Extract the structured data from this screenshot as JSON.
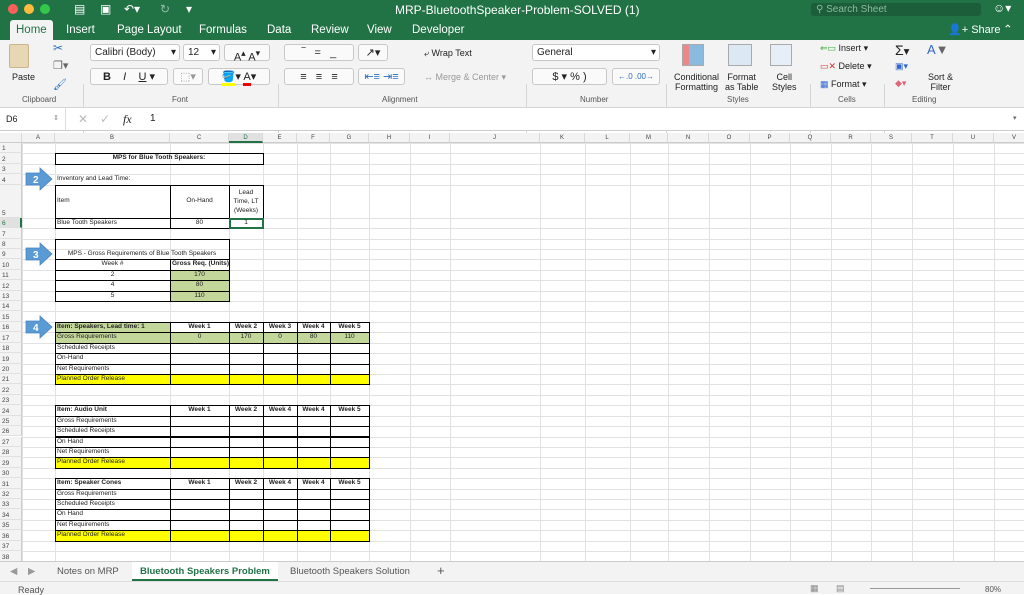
{
  "window": {
    "title": "MRP-BluetoothSpeaker-Problem-SOLVED (1)",
    "search_placeholder": "Search Sheet",
    "share_label": "Share"
  },
  "ribbon_tabs": [
    "Home",
    "Insert",
    "Page Layout",
    "Formulas",
    "Data",
    "Review",
    "View",
    "Developer"
  ],
  "active_tab": "Home",
  "ribbon": {
    "paste": "Paste",
    "font_name": "Calibri (Body)",
    "font_size": "12",
    "bold": "B",
    "italic": "I",
    "underline": "U",
    "wrap_text": "Wrap Text",
    "merge_center": "Merge & Center",
    "number_format": "General",
    "currency": "$",
    "percent": "%",
    "comma": ")",
    "conditional_formatting": [
      "Conditional",
      "Formatting"
    ],
    "format_as_table": [
      "Format",
      "as Table"
    ],
    "cell_styles": [
      "Cell",
      "Styles"
    ],
    "insert": "Insert",
    "delete": "Delete",
    "format": "Format",
    "sort_filter": [
      "Sort &",
      "Filter"
    ],
    "groups": {
      "clipboard": "Clipboard",
      "font": "Font",
      "alignment": "Alignment",
      "number": "Number",
      "styles": "Styles",
      "cells": "Cells",
      "editing": "Editing"
    }
  },
  "formula_bar": {
    "name_box": "D6",
    "formula": "1",
    "fx": "fx"
  },
  "columns": [
    "A",
    "B",
    "C",
    "D",
    "E",
    "F",
    "G",
    "H",
    "I",
    "J",
    "K",
    "L",
    "M",
    "N",
    "O",
    "P",
    "Q",
    "R",
    "S",
    "T",
    "U",
    "V"
  ],
  "selected_cell": "D6",
  "colors": {
    "green_fill": "#c4d79b",
    "yellow_fill": "#ffff00",
    "accent": "#217346",
    "arrow": "#5b9bd5"
  },
  "callouts": [
    {
      "label": "2",
      "row": 4
    },
    {
      "label": "3",
      "row": 9
    },
    {
      "label": "4",
      "row": 16
    }
  ],
  "cells": [
    {
      "ref": "B2",
      "text": "MPS for Blue Tooth Speakers:"
    },
    {
      "ref": "B4",
      "text": "Inventory and Lead Time:"
    },
    {
      "ref": "B5",
      "text": "Item"
    },
    {
      "ref": "C5",
      "text": "On-Hand"
    },
    {
      "ref": "D5",
      "text": "Lead Time, LT (Weeks)"
    },
    {
      "ref": "B6",
      "text": "Blue Tooth Speakers"
    },
    {
      "ref": "C6",
      "text": "80"
    },
    {
      "ref": "D6",
      "text": "1"
    },
    {
      "ref": "B9",
      "text": "MPS - Gross Requirements of Blue Tooth Speakers"
    },
    {
      "ref": "B10",
      "text": "Week #"
    },
    {
      "ref": "C10",
      "text": "Gross Req. (Units)"
    },
    {
      "ref": "B11",
      "text": "2"
    },
    {
      "ref": "C11",
      "text": "170"
    },
    {
      "ref": "B12",
      "text": "4"
    },
    {
      "ref": "C12",
      "text": "80"
    },
    {
      "ref": "B13",
      "text": "5"
    },
    {
      "ref": "C13",
      "text": "110"
    },
    {
      "ref": "B16",
      "text": "Item: Speakers, Lead time: 1"
    },
    {
      "ref": "C16",
      "text": "Week 1"
    },
    {
      "ref": "D16",
      "text": "Week 2"
    },
    {
      "ref": "E16",
      "text": "Week 3"
    },
    {
      "ref": "F16",
      "text": "Week 4"
    },
    {
      "ref": "G16",
      "text": "Week 5"
    },
    {
      "ref": "B17",
      "text": "Gross Requirements"
    },
    {
      "ref": "C17",
      "text": "0"
    },
    {
      "ref": "D17",
      "text": "170"
    },
    {
      "ref": "E17",
      "text": "0"
    },
    {
      "ref": "F17",
      "text": "80"
    },
    {
      "ref": "G17",
      "text": "110"
    },
    {
      "ref": "B18",
      "text": "Scheduled Receipts"
    },
    {
      "ref": "B19",
      "text": "On-Hand"
    },
    {
      "ref": "B20",
      "text": "Net Requirements"
    },
    {
      "ref": "B21",
      "text": "Planned Order Release"
    },
    {
      "ref": "B24",
      "text": "Item: Audio Unit"
    },
    {
      "ref": "C24",
      "text": "Week 1"
    },
    {
      "ref": "D24",
      "text": "Week 2"
    },
    {
      "ref": "E24",
      "text": "Week 4"
    },
    {
      "ref": "F24",
      "text": "Week 4"
    },
    {
      "ref": "G24",
      "text": "Week 5"
    },
    {
      "ref": "B25",
      "text": "Gross Requirements"
    },
    {
      "ref": "B26",
      "text": "Scheduled Receipts"
    },
    {
      "ref": "B27",
      "text": "On Hand"
    },
    {
      "ref": "B28",
      "text": "Net Requirements"
    },
    {
      "ref": "B29",
      "text": "Planned Order Release"
    },
    {
      "ref": "B31",
      "text": "Item: Speaker Cones"
    },
    {
      "ref": "C31",
      "text": "Week 1"
    },
    {
      "ref": "D31",
      "text": "Week 2"
    },
    {
      "ref": "E31",
      "text": "Week 4"
    },
    {
      "ref": "F31",
      "text": "Week 4"
    },
    {
      "ref": "G31",
      "text": "Week 5"
    },
    {
      "ref": "B32",
      "text": "Gross Requirements"
    },
    {
      "ref": "B33",
      "text": "Scheduled Receipts"
    },
    {
      "ref": "B34",
      "text": "On Hand"
    },
    {
      "ref": "B35",
      "text": "Net Requirements"
    },
    {
      "ref": "B36",
      "text": "Planned Order Release"
    }
  ],
  "sheet_tabs": [
    {
      "label": "Notes on MRP"
    },
    {
      "label": "Bluetooth Speakers Problem",
      "active": true
    },
    {
      "label": "Bluetooth Speakers Solution"
    }
  ],
  "add_sheet": "+",
  "status": {
    "ready": "Ready",
    "zoom": "80%"
  }
}
